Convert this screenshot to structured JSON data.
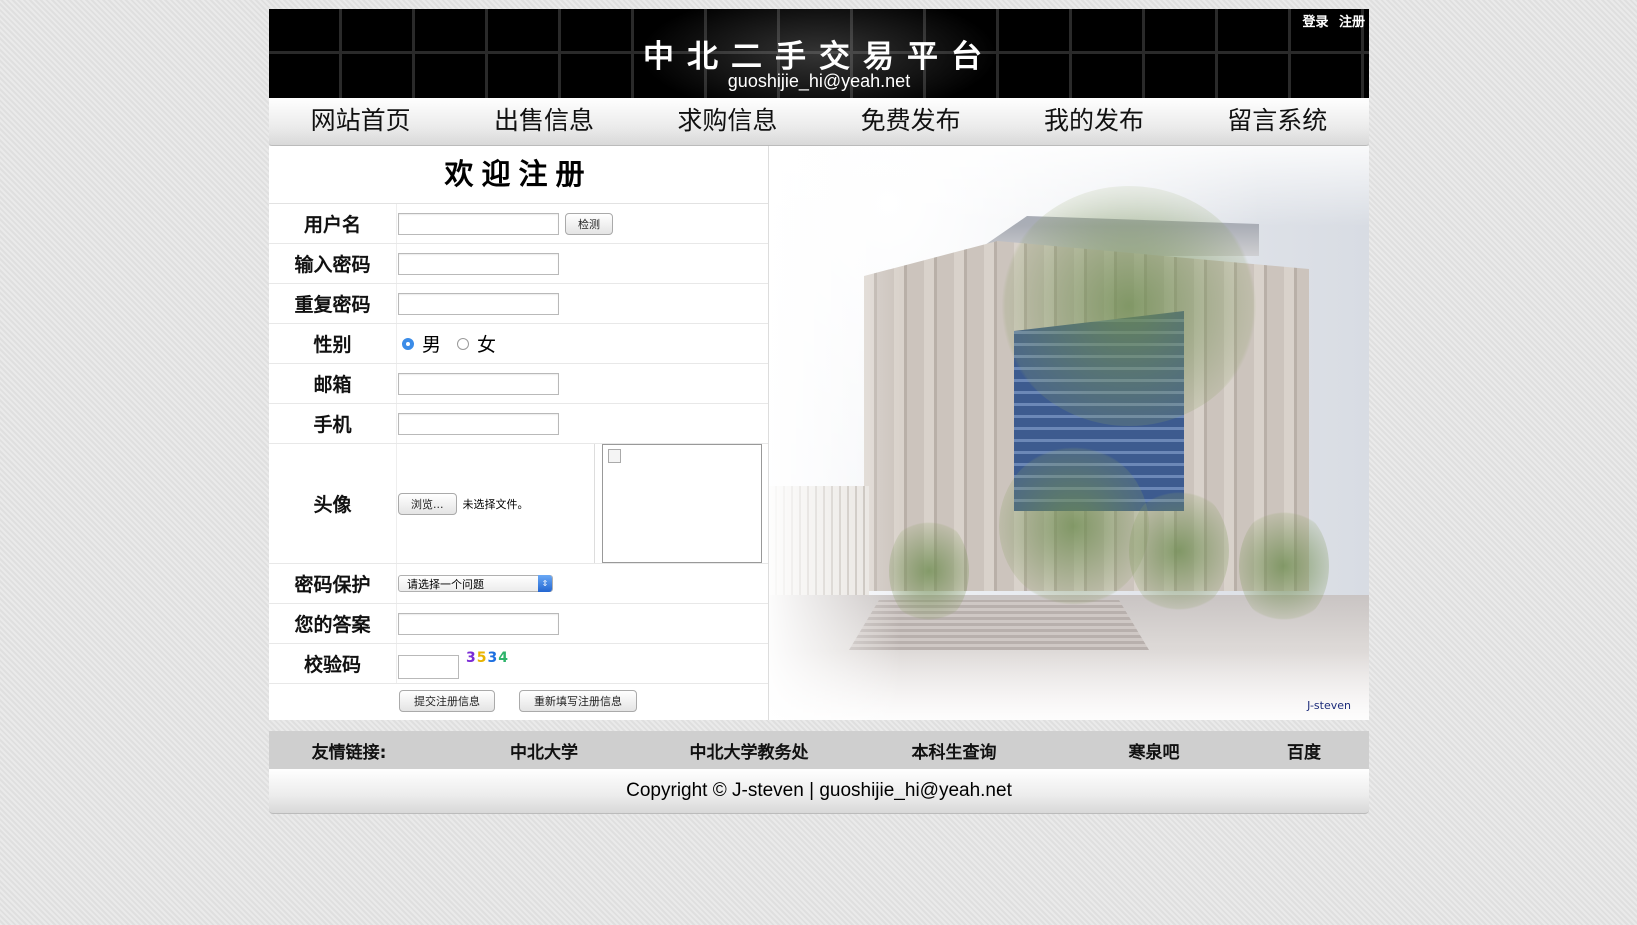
{
  "header": {
    "title": "中北二手交易平台",
    "email": "guoshijie_hi@yeah.net",
    "login": "登录",
    "register": "注册"
  },
  "nav": [
    {
      "label": "网站首页"
    },
    {
      "label": "出售信息"
    },
    {
      "label": "求购信息"
    },
    {
      "label": "免费发布"
    },
    {
      "label": "我的发布"
    },
    {
      "label": "留言系统"
    }
  ],
  "form": {
    "title": "欢迎注册",
    "username_label": "用户名",
    "check_button": "检测",
    "password_label": "输入密码",
    "repeat_label": "重复密码",
    "gender_label": "性别",
    "gender_male": "男",
    "gender_female": "女",
    "gender_selected": "男",
    "email_label": "邮箱",
    "phone_label": "手机",
    "avatar_label": "头像",
    "browse_button": "浏览...",
    "file_status": "未选择文件。",
    "question_label": "密码保护",
    "question_selected": "请选择一个问题",
    "answer_label": "您的答案",
    "captcha_label": "校验码",
    "captcha_code": [
      "3",
      "5",
      "3",
      "4"
    ],
    "captcha_colors": [
      "#7a2bd6",
      "#e8b400",
      "#1d6fe0",
      "#2db36a"
    ],
    "submit_button": "提交注册信息",
    "reset_button": "重新填写注册信息"
  },
  "photo": {
    "signature": "J-steven"
  },
  "footer": {
    "links_label": "友情链接:",
    "links": [
      {
        "label": "中北大学"
      },
      {
        "label": "中北大学教务处"
      },
      {
        "label": "本科生查询"
      },
      {
        "label": "寒泉吧"
      },
      {
        "label": "百度"
      }
    ],
    "copyright": "Copyright © J-steven | guoshijie_hi@yeah.net"
  }
}
